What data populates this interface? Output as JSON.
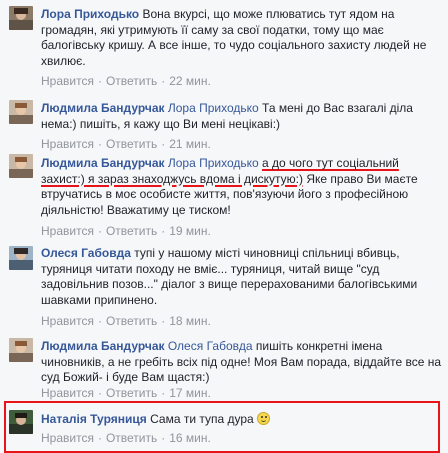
{
  "comments": [
    {
      "author": "Лора Приходько",
      "reply_to": "",
      "text": "Вона вкурсі, що може плюватись тут ядом на громадян, які утримують її саму за свої податки, тому що має балогівську кришу. А все інше, то чудо соціального захисту людей не хвилює.",
      "like": "Нравится",
      "reply": "Ответить",
      "time": "22 мин."
    },
    {
      "author": "Людмила Бандурчак",
      "reply_to": "Лора Приходько",
      "text": "Та мені до Вас взагалі діла нема:) пишіть, я кажу що Ви мені нецікаві:)",
      "like": "Нравится",
      "reply": "Ответить",
      "time": "21 мин."
    },
    {
      "author": "Людмила Бандурчак",
      "reply_to": "Лора Приходько",
      "text_part1": "а до чого тут соціальний захист:) я зараз знаходжусь вдома і дискутую:)",
      "text_part2": " Яке право Ви маєте втручатись в моє особисте життя, пов'язуючи його з професійною діяльністю! Вважатиму це тиском!",
      "like": "Нравится",
      "reply": "Ответить",
      "time": "19 мин."
    },
    {
      "author": "Олеся Габовда",
      "reply_to": "",
      "text": "тупі у нашому місті чиновниці спільниці вбивць, туряниця читати походу не вміє... туряниця, читай вище \"суд задовільнив позов...\" діалог з вище перерахованими балогівськими шавками припинено.",
      "like": "Нравится",
      "reply": "Ответить",
      "time": "18 мин."
    },
    {
      "author": "Людмила Бандурчак",
      "reply_to": "Олеся Габовда",
      "text": "пишіть конкретні імена чиновників, а не гребіть всіх під одне! Моя Вам порада, віддайте все на суд Божий- і буде Вам щастя:)",
      "like": "Нравится",
      "reply": "Ответить",
      "time": "17 мин."
    },
    {
      "author": "Наталія Туряниця",
      "reply_to": "",
      "text": "Сама ти тупа дура",
      "like": "Нравится",
      "reply": "Ответить",
      "time": "16 мин."
    }
  ],
  "colors": {
    "author": "#365899",
    "meta": "#90949c",
    "highlight": "#e8141a"
  },
  "icons": [
    "avatar",
    "smiley-emoji-icon"
  ]
}
